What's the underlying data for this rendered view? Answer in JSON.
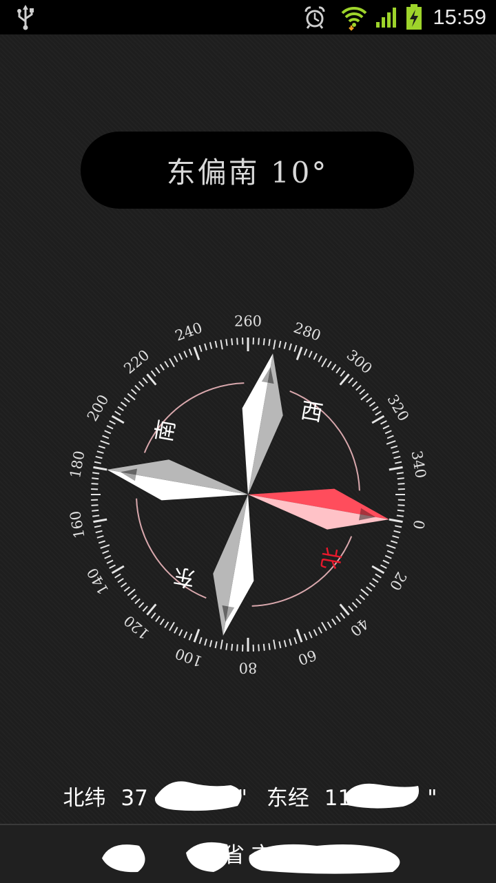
{
  "status_bar": {
    "time": "15:59",
    "icons": [
      "usb-icon",
      "alarm-icon",
      "wifi-icon",
      "signal-icon",
      "battery-charging-icon"
    ],
    "accent_color": "#9ed42b"
  },
  "heading": {
    "text": "东偏南 10°",
    "direction": "东偏南",
    "degrees": 10
  },
  "compass": {
    "rotation_deg": 100,
    "dial_labels": [
      "0",
      "20",
      "40",
      "60",
      "80",
      "100",
      "120",
      "140",
      "160",
      "180",
      "200",
      "220",
      "240",
      "260",
      "280",
      "300",
      "320",
      "340"
    ],
    "cardinals": {
      "north": "北",
      "east": "东",
      "south": "南",
      "west": "西"
    },
    "north_color": "#e8192c",
    "needle_color": "#ff5a66"
  },
  "location": {
    "latitude_label": "北纬",
    "latitude_value": "37",
    "longitude_label": "东经",
    "longitude_value": "11",
    "address_visible": "省 市"
  }
}
